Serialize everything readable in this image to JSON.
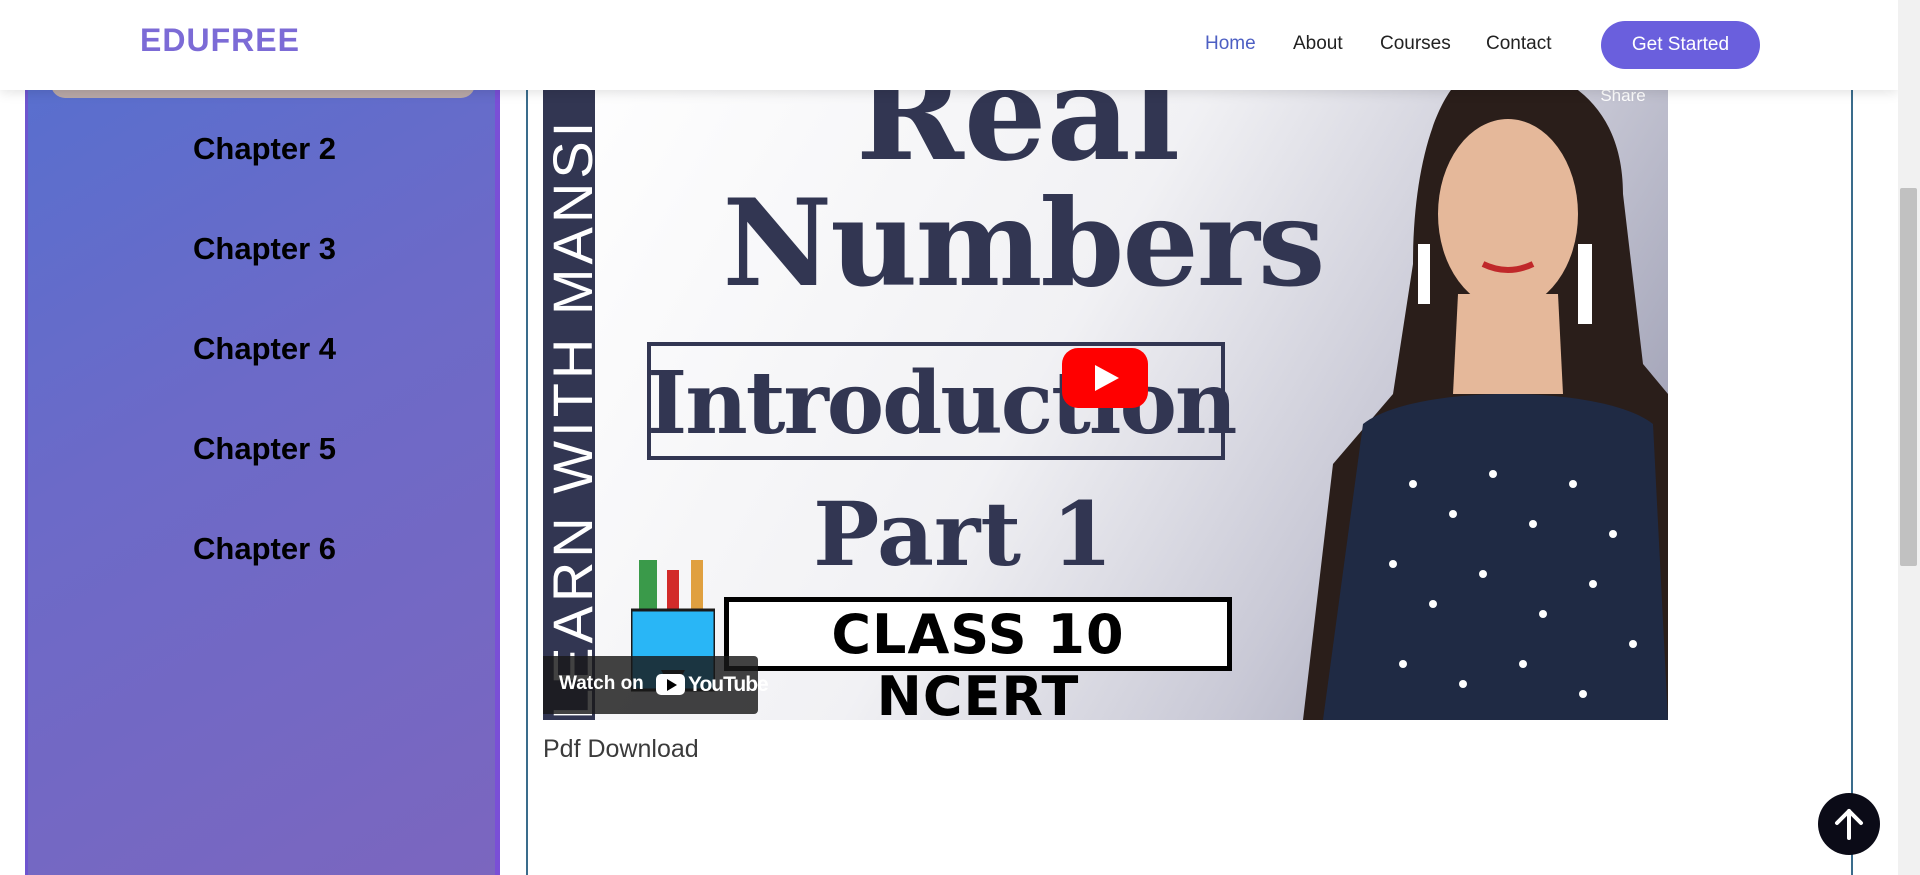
{
  "navbar": {
    "logo": "EDUFREE",
    "links": [
      {
        "label": "Home",
        "active": true
      },
      {
        "label": "About",
        "active": false
      },
      {
        "label": "Courses",
        "active": false
      },
      {
        "label": "Contact",
        "active": false
      }
    ],
    "cta_label": "Get Started"
  },
  "sidebar": {
    "chapters": [
      "Chapter 2",
      "Chapter 3",
      "Chapter 4",
      "Chapter 5",
      "Chapter 6"
    ]
  },
  "video": {
    "thumbnail_text": {
      "strip": "LEARN WITH MANSI",
      "line1": "Real",
      "line2": "Numbers",
      "line3": "Introduction",
      "line4": "Part 1",
      "line5": "CLASS 10 NCERT"
    },
    "share_label": "Share",
    "watch_on_label": "Watch on",
    "youtube_word": "YouTube"
  },
  "content": {
    "pdf_download_label": "Pdf Download"
  },
  "colors": {
    "brand": "#7c6bd6",
    "cta": "#6a5fdd",
    "active_link": "#4d5fc3",
    "sidebar_gradient_start": "#5570cf",
    "sidebar_gradient_end": "#7b66bf",
    "play_button": "#ff0000"
  },
  "icons": {
    "play": "play-icon",
    "youtube": "youtube-logo-icon",
    "back_to_top": "arrow-up-icon"
  }
}
